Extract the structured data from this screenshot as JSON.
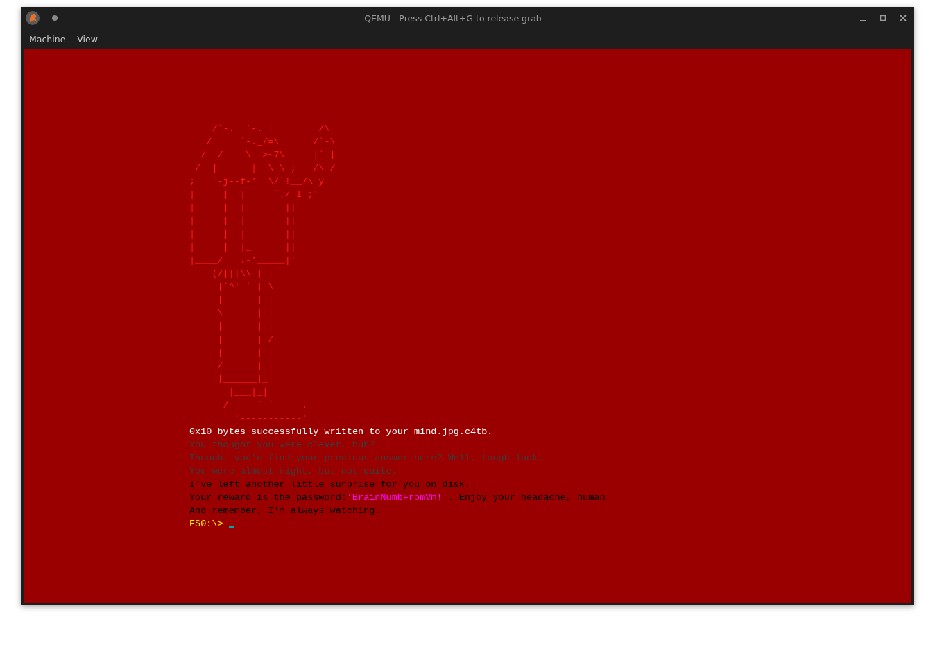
{
  "window": {
    "title": "QEMU - Press Ctrl+Alt+G to release grab"
  },
  "menu": [
    "Machine",
    "View"
  ],
  "console": {
    "art": [
      "    /`-._ `-._|        /\\",
      "   /     `-._/=\\      /`-\\",
      "  /  /    \\  >~7\\     |`-|",
      " /  |      |  \\-\\ ;   /\\ /",
      ";   `-j--f-'  \\/`!__7\\ y",
      "|     |  |     `./_I_;'",
      "|     |  |       ||",
      "|     |  |       ||",
      "|     |  |       ||",
      "|     |  |_      ||",
      "|____/   .-'_____|'",
      "    (/|||\\\\ | |",
      "     |`^' ` | \\",
      "     |      | |",
      "     \\      | |",
      "     |      | |",
      "     |      | /",
      "     |      | |",
      "     /      | |",
      "     |______|_|",
      "       |___|_|",
      "      /     `=`=====.",
      "      `='-----------'"
    ],
    "lines": [
      {
        "segments": [
          {
            "text": "0x10 bytes successfully written to your_mind.jpg.c4tb.",
            "color": "#ffffff"
          }
        ]
      },
      {
        "segments": [
          {
            "text": "You thought you were clever, huh?",
            "color": "#3c3c3c"
          }
        ]
      },
      {
        "segments": [
          {
            "text": "Thought you'd find your precious answer here? Well, tough luck.",
            "color": "#3c3c3c"
          }
        ]
      },
      {
        "segments": [
          {
            "text": "You were almost right, but not quite.",
            "color": "#3c3c3c"
          }
        ]
      },
      {
        "segments": [
          {
            "text": "I've left another little surprise for you on disk.",
            "color": "#000000"
          }
        ]
      },
      {
        "segments": [
          {
            "text": "Your reward is the password:",
            "color": "#000000"
          },
          {
            "text": "'BrainNumbFromVm!'",
            "color": "#ff00ff"
          },
          {
            "text": ". Enjoy your headache, human.",
            "color": "#000000"
          }
        ]
      },
      {
        "segments": [
          {
            "text": "And remember, I'm always watching.",
            "color": "#000000"
          }
        ]
      }
    ],
    "prompt": {
      "text": "FS0:\\>",
      "color": "#ffff00"
    }
  }
}
